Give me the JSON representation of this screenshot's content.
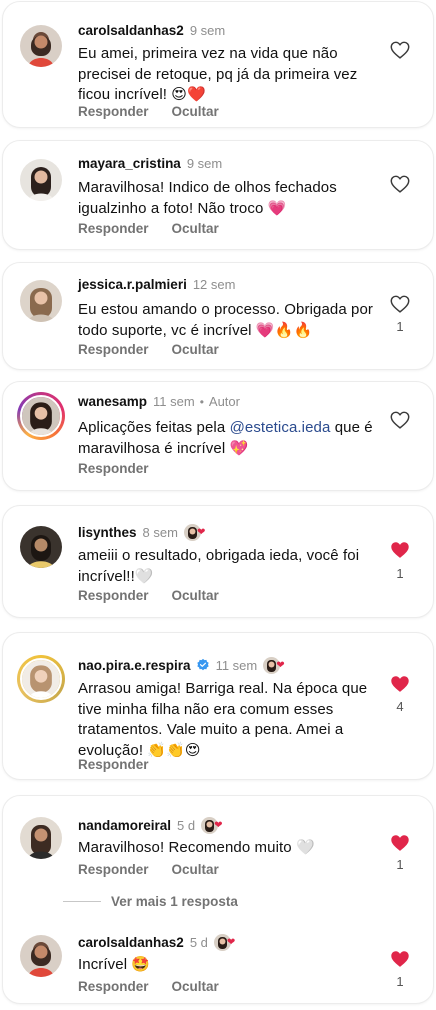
{
  "colors": {
    "liked": "#e0264a",
    "muted": "#8e8e8e",
    "mention": "#2b4b8e"
  },
  "comments": [
    {
      "username": "carolsaldanhas2",
      "time": "9 sem",
      "text": "Eu amei, primeira vez na vida que não precisei de retoque, pq já da primeira vez ficou incrível! 😍❤️",
      "reply": "Responder",
      "hide": "Ocultar",
      "liked": false,
      "likes": ""
    },
    {
      "username": "mayara_cristina",
      "time": "9 sem",
      "text": "Maravilhosa! Indico de olhos fechados igualzinho a foto! Não troco 💗",
      "reply": "Responder",
      "hide": "Ocultar",
      "liked": false,
      "likes": ""
    },
    {
      "username": "jessica.r.palmieri",
      "time": "12 sem",
      "text": "Eu estou amando o processo. Obrigada por todo suporte, vc é incrível 💗🔥🔥",
      "reply": "Responder",
      "hide": "Ocultar",
      "liked": false,
      "likes": "1"
    },
    {
      "username": "wanesamp",
      "time": "11 sem",
      "author_badge": "Autor",
      "text_before": "Aplicações feitas pela ",
      "mention": "@estetica.ieda",
      "text_after": " que é maravilhosa é incrível 💖",
      "reply": "Responder",
      "liked": false,
      "likes": ""
    },
    {
      "username": "lisynthes",
      "time": "8 sem",
      "text": "ameiii o resultado, obrigada ieda, você foi incrível!!🤍",
      "reply": "Responder",
      "hide": "Ocultar",
      "liked": true,
      "likes": "1"
    },
    {
      "username": "nao.pira.e.respira",
      "time": "11 sem",
      "text": "Arrasou amiga! Barriga real. Na época que tive minha filha não era comum esses tratamentos. Vale muito a pena. Amei a evolução! 👏👏😍",
      "reply": "Responder",
      "liked": true,
      "likes": "4"
    },
    {
      "username": "nandamoreiral",
      "time": "5 d",
      "text": "Maravilhoso! Recomendo muito 🤍",
      "reply": "Responder",
      "hide": "Ocultar",
      "liked": true,
      "likes": "1"
    },
    {
      "username": "carolsaldanhas2",
      "time": "5 d",
      "text": "Incrível 🤩",
      "reply": "Responder",
      "hide": "Ocultar",
      "liked": true,
      "likes": "1"
    }
  ],
  "more_replies": "Ver mais 1 resposta"
}
